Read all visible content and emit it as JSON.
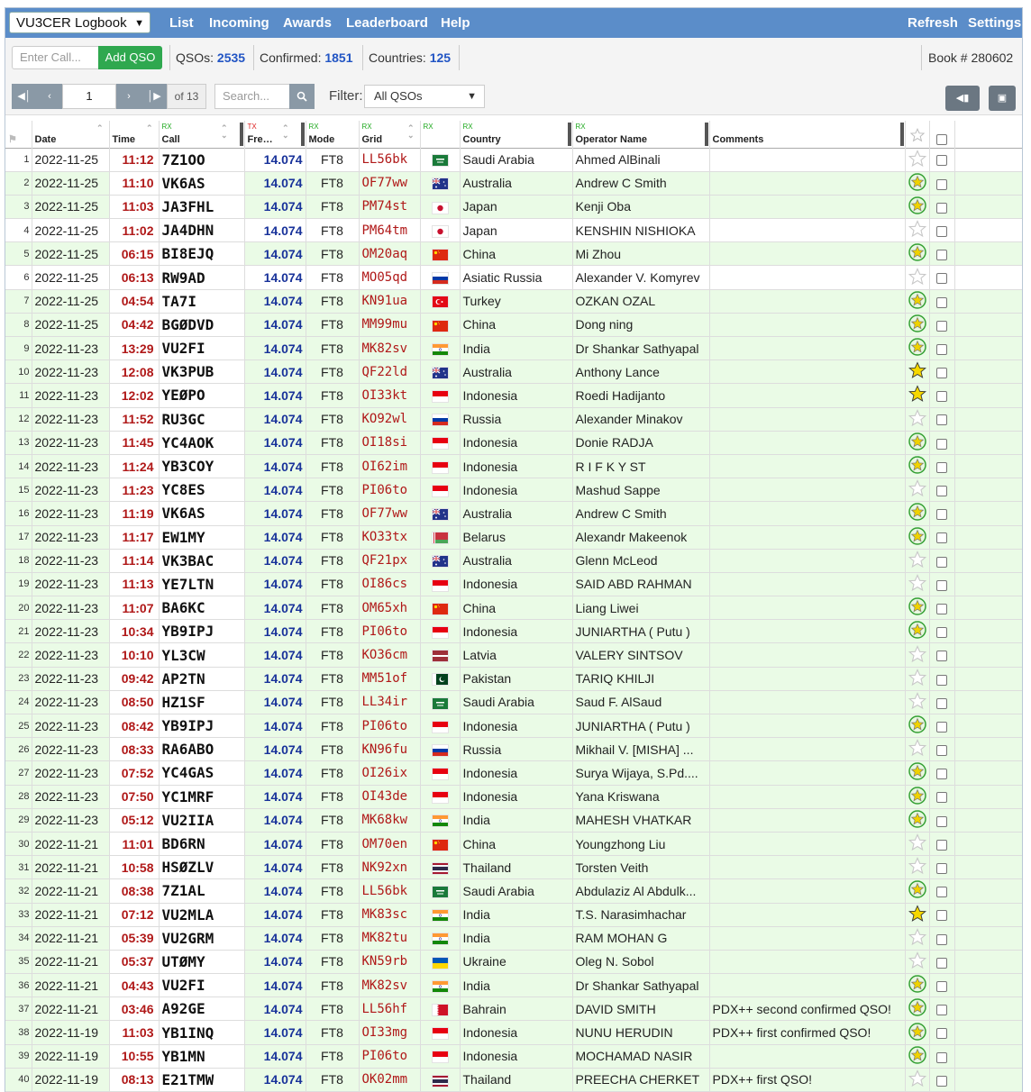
{
  "nav": {
    "logbook_select": "VU3CER Logbook",
    "links": [
      "List",
      "Incoming",
      "Awards",
      "Leaderboard",
      "Help"
    ],
    "refresh": "Refresh",
    "settings": "Settings"
  },
  "toolbar": {
    "call_placeholder": "Enter Call...",
    "add_qso": "Add QSO",
    "qsos_label": "QSOs:",
    "qsos_value": "2535",
    "confirmed_label": "Confirmed:",
    "confirmed_value": "1851",
    "countries_label": "Countries:",
    "countries_value": "125",
    "book": "Book # 280602",
    "page": "1",
    "of_pages": "of 13",
    "search_placeholder": "Search...",
    "filter_label": "Filter:",
    "filter_value": "All QSOs"
  },
  "columns": {
    "date": "Date",
    "time": "Time",
    "call": "Call",
    "freq": "Fre…",
    "mode": "Mode",
    "grid": "Grid",
    "country": "Country",
    "operator": "Operator Name",
    "comments": "Comments",
    "rx": "RX",
    "tx": "TX"
  },
  "colors": {
    "navbar": "#5b8dc9",
    "confirmed_row": "#eafbe6",
    "time": "#b01818",
    "freq": "#18329a",
    "add_button": "#2fa84f"
  },
  "rows": [
    {
      "n": "1",
      "date": "2022-11-25",
      "time": "11:12",
      "call": "7Z1OO",
      "freq": "14.074",
      "mode": "FT8",
      "grid": "LL56bk",
      "flag": "sa",
      "country": "Saudi Arabia",
      "op": "Ahmed AlBinali",
      "comment": "",
      "star": "empty",
      "conf": false
    },
    {
      "n": "2",
      "date": "2022-11-25",
      "time": "11:10",
      "call": "VK6AS",
      "freq": "14.074",
      "mode": "FT8",
      "grid": "OF77ww",
      "flag": "au",
      "country": "Australia",
      "op": "Andrew C Smith",
      "comment": "",
      "star": "green",
      "conf": true
    },
    {
      "n": "3",
      "date": "2022-11-25",
      "time": "11:03",
      "call": "JA3FHL",
      "freq": "14.074",
      "mode": "FT8",
      "grid": "PM74st",
      "flag": "jp",
      "country": "Japan",
      "op": "Kenji Oba",
      "comment": "",
      "star": "green",
      "conf": true
    },
    {
      "n": "4",
      "date": "2022-11-25",
      "time": "11:02",
      "call": "JA4DHN",
      "freq": "14.074",
      "mode": "FT8",
      "grid": "PM64tm",
      "flag": "jp",
      "country": "Japan",
      "op": "KENSHIN NISHIOKA",
      "comment": "",
      "star": "empty",
      "conf": false
    },
    {
      "n": "5",
      "date": "2022-11-25",
      "time": "06:15",
      "call": "BI8EJQ",
      "freq": "14.074",
      "mode": "FT8",
      "grid": "OM20aq",
      "flag": "cn",
      "country": "China",
      "op": "Mi Zhou",
      "comment": "",
      "star": "green",
      "conf": true
    },
    {
      "n": "6",
      "date": "2022-11-25",
      "time": "06:13",
      "call": "RW9AD",
      "freq": "14.074",
      "mode": "FT8",
      "grid": "MO05qd",
      "flag": "ru",
      "country": "Asiatic Russia",
      "op": "Alexander V. Komyrev",
      "comment": "",
      "star": "empty",
      "conf": false
    },
    {
      "n": "7",
      "date": "2022-11-25",
      "time": "04:54",
      "call": "TA7I",
      "freq": "14.074",
      "mode": "FT8",
      "grid": "KN91ua",
      "flag": "tr",
      "country": "Turkey",
      "op": "OZKAN OZAL",
      "comment": "",
      "star": "green",
      "conf": true
    },
    {
      "n": "8",
      "date": "2022-11-25",
      "time": "04:42",
      "call": "BGØDVD",
      "freq": "14.074",
      "mode": "FT8",
      "grid": "MM99mu",
      "flag": "cn",
      "country": "China",
      "op": "Dong ning",
      "comment": "",
      "star": "green",
      "conf": true
    },
    {
      "n": "9",
      "date": "2022-11-23",
      "time": "13:29",
      "call": "VU2FI",
      "freq": "14.074",
      "mode": "FT8",
      "grid": "MK82sv",
      "flag": "in",
      "country": "India",
      "op": "Dr Shankar Sathyapal",
      "comment": "",
      "star": "green",
      "conf": true
    },
    {
      "n": "10",
      "date": "2022-11-23",
      "time": "12:08",
      "call": "VK3PUB",
      "freq": "14.074",
      "mode": "FT8",
      "grid": "QF22ld",
      "flag": "au",
      "country": "Australia",
      "op": "Anthony Lance",
      "comment": "",
      "star": "gold",
      "conf": true
    },
    {
      "n": "11",
      "date": "2022-11-23",
      "time": "12:02",
      "call": "YEØPO",
      "freq": "14.074",
      "mode": "FT8",
      "grid": "OI33kt",
      "flag": "id",
      "country": "Indonesia",
      "op": "Roedi Hadijanto",
      "comment": "",
      "star": "gold",
      "conf": true
    },
    {
      "n": "12",
      "date": "2022-11-23",
      "time": "11:52",
      "call": "RU3GC",
      "freq": "14.074",
      "mode": "FT8",
      "grid": "KO92wl",
      "flag": "ru",
      "country": "Russia",
      "op": "Alexander Minakov",
      "comment": "",
      "star": "empty",
      "conf": true
    },
    {
      "n": "13",
      "date": "2022-11-23",
      "time": "11:45",
      "call": "YC4AOK",
      "freq": "14.074",
      "mode": "FT8",
      "grid": "OI18si",
      "flag": "id",
      "country": "Indonesia",
      "op": "Donie RADJA",
      "comment": "",
      "star": "green",
      "conf": true
    },
    {
      "n": "14",
      "date": "2022-11-23",
      "time": "11:24",
      "call": "YB3COY",
      "freq": "14.074",
      "mode": "FT8",
      "grid": "OI62im",
      "flag": "id",
      "country": "Indonesia",
      "op": "R I F K Y ST",
      "comment": "",
      "star": "green",
      "conf": true
    },
    {
      "n": "15",
      "date": "2022-11-23",
      "time": "11:23",
      "call": "YC8ES",
      "freq": "14.074",
      "mode": "FT8",
      "grid": "PI06to",
      "flag": "id",
      "country": "Indonesia",
      "op": "Mashud Sappe",
      "comment": "",
      "star": "empty",
      "conf": true
    },
    {
      "n": "16",
      "date": "2022-11-23",
      "time": "11:19",
      "call": "VK6AS",
      "freq": "14.074",
      "mode": "FT8",
      "grid": "OF77ww",
      "flag": "au",
      "country": "Australia",
      "op": "Andrew C Smith",
      "comment": "",
      "star": "green",
      "conf": true
    },
    {
      "n": "17",
      "date": "2022-11-23",
      "time": "11:17",
      "call": "EW1MY",
      "freq": "14.074",
      "mode": "FT8",
      "grid": "KO33tx",
      "flag": "by",
      "country": "Belarus",
      "op": "Alexandr Makeenok",
      "comment": "",
      "star": "green",
      "conf": true
    },
    {
      "n": "18",
      "date": "2022-11-23",
      "time": "11:14",
      "call": "VK3BAC",
      "freq": "14.074",
      "mode": "FT8",
      "grid": "QF21px",
      "flag": "au",
      "country": "Australia",
      "op": "Glenn McLeod",
      "comment": "",
      "star": "empty",
      "conf": true
    },
    {
      "n": "19",
      "date": "2022-11-23",
      "time": "11:13",
      "call": "YE7LTN",
      "freq": "14.074",
      "mode": "FT8",
      "grid": "OI86cs",
      "flag": "id",
      "country": "Indonesia",
      "op": "SAID ABD RAHMAN",
      "comment": "",
      "star": "empty",
      "conf": true
    },
    {
      "n": "20",
      "date": "2022-11-23",
      "time": "11:07",
      "call": "BA6KC",
      "freq": "14.074",
      "mode": "FT8",
      "grid": "OM65xh",
      "flag": "cn",
      "country": "China",
      "op": "Liang Liwei",
      "comment": "",
      "star": "green",
      "conf": true
    },
    {
      "n": "21",
      "date": "2022-11-23",
      "time": "10:34",
      "call": "YB9IPJ",
      "freq": "14.074",
      "mode": "FT8",
      "grid": "PI06to",
      "flag": "id",
      "country": "Indonesia",
      "op": "JUNIARTHA ( Putu )",
      "comment": "",
      "star": "green",
      "conf": true
    },
    {
      "n": "22",
      "date": "2022-11-23",
      "time": "10:10",
      "call": "YL3CW",
      "freq": "14.074",
      "mode": "FT8",
      "grid": "KO36cm",
      "flag": "lv",
      "country": "Latvia",
      "op": "VALERY SINTSOV",
      "comment": "",
      "star": "empty",
      "conf": true
    },
    {
      "n": "23",
      "date": "2022-11-23",
      "time": "09:42",
      "call": "AP2TN",
      "freq": "14.074",
      "mode": "FT8",
      "grid": "MM51of",
      "flag": "pk",
      "country": "Pakistan",
      "op": "TARIQ KHILJI",
      "comment": "",
      "star": "empty",
      "conf": true
    },
    {
      "n": "24",
      "date": "2022-11-23",
      "time": "08:50",
      "call": "HZ1SF",
      "freq": "14.074",
      "mode": "FT8",
      "grid": "LL34ir",
      "flag": "sa",
      "country": "Saudi Arabia",
      "op": "Saud F. AlSaud",
      "comment": "",
      "star": "empty",
      "conf": true
    },
    {
      "n": "25",
      "date": "2022-11-23",
      "time": "08:42",
      "call": "YB9IPJ",
      "freq": "14.074",
      "mode": "FT8",
      "grid": "PI06to",
      "flag": "id",
      "country": "Indonesia",
      "op": "JUNIARTHA ( Putu )",
      "comment": "",
      "star": "green",
      "conf": true
    },
    {
      "n": "26",
      "date": "2022-11-23",
      "time": "08:33",
      "call": "RA6ABO",
      "freq": "14.074",
      "mode": "FT8",
      "grid": "KN96fu",
      "flag": "ru",
      "country": "Russia",
      "op": "Mikhail V. [MISHA] ...",
      "comment": "",
      "star": "empty",
      "conf": true
    },
    {
      "n": "27",
      "date": "2022-11-23",
      "time": "07:52",
      "call": "YC4GAS",
      "freq": "14.074",
      "mode": "FT8",
      "grid": "OI26ix",
      "flag": "id",
      "country": "Indonesia",
      "op": "Surya Wijaya, S.Pd....",
      "comment": "",
      "star": "green",
      "conf": true
    },
    {
      "n": "28",
      "date": "2022-11-23",
      "time": "07:50",
      "call": "YC1MRF",
      "freq": "14.074",
      "mode": "FT8",
      "grid": "OI43de",
      "flag": "id",
      "country": "Indonesia",
      "op": "Yana Kriswana",
      "comment": "",
      "star": "green",
      "conf": true
    },
    {
      "n": "29",
      "date": "2022-11-23",
      "time": "05:12",
      "call": "VU2IIA",
      "freq": "14.074",
      "mode": "FT8",
      "grid": "MK68kw",
      "flag": "in",
      "country": "India",
      "op": "MAHESH VHATKAR",
      "comment": "",
      "star": "green",
      "conf": true
    },
    {
      "n": "30",
      "date": "2022-11-21",
      "time": "11:01",
      "call": "BD6RN",
      "freq": "14.074",
      "mode": "FT8",
      "grid": "OM70en",
      "flag": "cn",
      "country": "China",
      "op": "Youngzhong Liu",
      "comment": "",
      "star": "empty",
      "conf": true
    },
    {
      "n": "31",
      "date": "2022-11-21",
      "time": "10:58",
      "call": "HSØZLV",
      "freq": "14.074",
      "mode": "FT8",
      "grid": "NK92xn",
      "flag": "th",
      "country": "Thailand",
      "op": "Torsten Veith",
      "comment": "",
      "star": "empty",
      "conf": true
    },
    {
      "n": "32",
      "date": "2022-11-21",
      "time": "08:38",
      "call": "7Z1AL",
      "freq": "14.074",
      "mode": "FT8",
      "grid": "LL56bk",
      "flag": "sa",
      "country": "Saudi Arabia",
      "op": "Abdulaziz Al Abdulk...",
      "comment": "",
      "star": "green",
      "conf": true
    },
    {
      "n": "33",
      "date": "2022-11-21",
      "time": "07:12",
      "call": "VU2MLA",
      "freq": "14.074",
      "mode": "FT8",
      "grid": "MK83sc",
      "flag": "in",
      "country": "India",
      "op": "T.S. Narasimhachar",
      "comment": "",
      "star": "gold",
      "conf": true
    },
    {
      "n": "34",
      "date": "2022-11-21",
      "time": "05:39",
      "call": "VU2GRM",
      "freq": "14.074",
      "mode": "FT8",
      "grid": "MK82tu",
      "flag": "in",
      "country": "India",
      "op": "RAM MOHAN G",
      "comment": "",
      "star": "empty",
      "conf": true
    },
    {
      "n": "35",
      "date": "2022-11-21",
      "time": "05:37",
      "call": "UTØMY",
      "freq": "14.074",
      "mode": "FT8",
      "grid": "KN59rb",
      "flag": "ua",
      "country": "Ukraine",
      "op": "Oleg N. Sobol",
      "comment": "",
      "star": "empty",
      "conf": true
    },
    {
      "n": "36",
      "date": "2022-11-21",
      "time": "04:43",
      "call": "VU2FI",
      "freq": "14.074",
      "mode": "FT8",
      "grid": "MK82sv",
      "flag": "in",
      "country": "India",
      "op": "Dr Shankar Sathyapal",
      "comment": "",
      "star": "green",
      "conf": true
    },
    {
      "n": "37",
      "date": "2022-11-21",
      "time": "03:46",
      "call": "A92GE",
      "freq": "14.074",
      "mode": "FT8",
      "grid": "LL56hf",
      "flag": "bh",
      "country": "Bahrain",
      "op": "DAVID SMITH",
      "comment": "PDX++ second confirmed QSO!",
      "star": "green",
      "conf": true
    },
    {
      "n": "38",
      "date": "2022-11-19",
      "time": "11:03",
      "call": "YB1INQ",
      "freq": "14.074",
      "mode": "FT8",
      "grid": "OI33mg",
      "flag": "id",
      "country": "Indonesia",
      "op": "NUNU HERUDIN",
      "comment": "PDX++ first confirmed QSO!",
      "star": "green",
      "conf": true
    },
    {
      "n": "39",
      "date": "2022-11-19",
      "time": "10:55",
      "call": "YB1MN",
      "freq": "14.074",
      "mode": "FT8",
      "grid": "PI06to",
      "flag": "id",
      "country": "Indonesia",
      "op": "MOCHAMAD NASIR",
      "comment": "",
      "star": "green",
      "conf": true
    },
    {
      "n": "40",
      "date": "2022-11-19",
      "time": "08:13",
      "call": "E21TMW",
      "freq": "14.074",
      "mode": "FT8",
      "grid": "OK02mm",
      "flag": "th",
      "country": "Thailand",
      "op": "PREECHA CHERKET",
      "comment": "PDX++ first QSO!",
      "star": "empty",
      "conf": true
    }
  ]
}
